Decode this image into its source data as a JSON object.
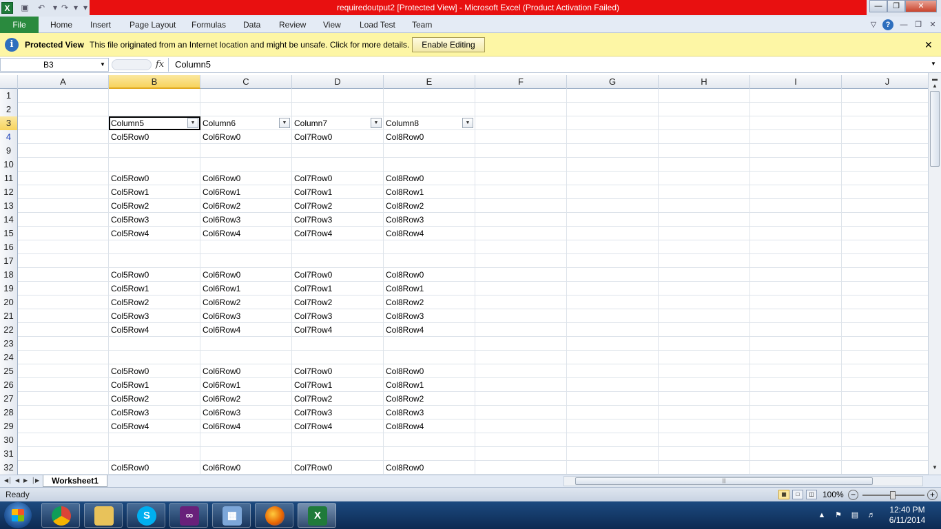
{
  "window": {
    "title": "requiredoutput2  [Protected View]  -  Microsoft Excel (Product Activation Failed)"
  },
  "ribbon": {
    "file_tab": "File",
    "tabs": [
      "Home",
      "Insert",
      "Page Layout",
      "Formulas",
      "Data",
      "Review",
      "View",
      "Load Test",
      "Team"
    ]
  },
  "protected_view": {
    "title": "Protected View",
    "message": "This file originated from an Internet location and might be unsafe. Click for more details.",
    "enable_button": "Enable Editing"
  },
  "formula_bar": {
    "name_box": "B3",
    "fx": "fx",
    "formula": "Column5"
  },
  "grid": {
    "selected_cell": "B3",
    "columns": [
      "A",
      "B",
      "C",
      "D",
      "E",
      "F",
      "G",
      "H",
      "I",
      "J"
    ],
    "rows": [
      {
        "num": "1",
        "cells": [
          "",
          "",
          "",
          "",
          ""
        ]
      },
      {
        "num": "2",
        "cells": [
          "",
          "",
          "",
          "",
          ""
        ]
      },
      {
        "num": "3",
        "cells": [
          "",
          "Column5",
          "Column6",
          "Column7",
          "Column8"
        ],
        "header": true
      },
      {
        "num": "4",
        "cells": [
          "",
          "Col5Row0",
          "Col6Row0",
          "Col7Row0",
          "Col8Row0"
        ],
        "filtered": true
      },
      {
        "num": "9",
        "cells": [
          "",
          "",
          "",
          "",
          ""
        ]
      },
      {
        "num": "10",
        "cells": [
          "",
          "",
          "",
          "",
          ""
        ]
      },
      {
        "num": "11",
        "cells": [
          "",
          "Col5Row0",
          "Col6Row0",
          "Col7Row0",
          "Col8Row0"
        ]
      },
      {
        "num": "12",
        "cells": [
          "",
          "Col5Row1",
          "Col6Row1",
          "Col7Row1",
          "Col8Row1"
        ]
      },
      {
        "num": "13",
        "cells": [
          "",
          "Col5Row2",
          "Col6Row2",
          "Col7Row2",
          "Col8Row2"
        ]
      },
      {
        "num": "14",
        "cells": [
          "",
          "Col5Row3",
          "Col6Row3",
          "Col7Row3",
          "Col8Row3"
        ]
      },
      {
        "num": "15",
        "cells": [
          "",
          "Col5Row4",
          "Col6Row4",
          "Col7Row4",
          "Col8Row4"
        ]
      },
      {
        "num": "16",
        "cells": [
          "",
          "",
          "",
          "",
          ""
        ]
      },
      {
        "num": "17",
        "cells": [
          "",
          "",
          "",
          "",
          ""
        ]
      },
      {
        "num": "18",
        "cells": [
          "",
          "Col5Row0",
          "Col6Row0",
          "Col7Row0",
          "Col8Row0"
        ]
      },
      {
        "num": "19",
        "cells": [
          "",
          "Col5Row1",
          "Col6Row1",
          "Col7Row1",
          "Col8Row1"
        ]
      },
      {
        "num": "20",
        "cells": [
          "",
          "Col5Row2",
          "Col6Row2",
          "Col7Row2",
          "Col8Row2"
        ]
      },
      {
        "num": "21",
        "cells": [
          "",
          "Col5Row3",
          "Col6Row3",
          "Col7Row3",
          "Col8Row3"
        ]
      },
      {
        "num": "22",
        "cells": [
          "",
          "Col5Row4",
          "Col6Row4",
          "Col7Row4",
          "Col8Row4"
        ]
      },
      {
        "num": "23",
        "cells": [
          "",
          "",
          "",
          "",
          ""
        ]
      },
      {
        "num": "24",
        "cells": [
          "",
          "",
          "",
          "",
          ""
        ]
      },
      {
        "num": "25",
        "cells": [
          "",
          "Col5Row0",
          "Col6Row0",
          "Col7Row0",
          "Col8Row0"
        ]
      },
      {
        "num": "26",
        "cells": [
          "",
          "Col5Row1",
          "Col6Row1",
          "Col7Row1",
          "Col8Row1"
        ]
      },
      {
        "num": "27",
        "cells": [
          "",
          "Col5Row2",
          "Col6Row2",
          "Col7Row2",
          "Col8Row2"
        ]
      },
      {
        "num": "28",
        "cells": [
          "",
          "Col5Row3",
          "Col6Row3",
          "Col7Row3",
          "Col8Row3"
        ]
      },
      {
        "num": "29",
        "cells": [
          "",
          "Col5Row4",
          "Col6Row4",
          "Col7Row4",
          "Col8Row4"
        ]
      },
      {
        "num": "30",
        "cells": [
          "",
          "",
          "",
          "",
          ""
        ]
      },
      {
        "num": "31",
        "cells": [
          "",
          "",
          "",
          "",
          ""
        ]
      },
      {
        "num": "32",
        "cells": [
          "",
          "Col5Row0",
          "Col6Row0",
          "Col7Row0",
          "Col8Row0"
        ]
      }
    ]
  },
  "sheets": {
    "tabs": [
      "Worksheet1"
    ]
  },
  "status": {
    "ready": "Ready",
    "zoom": "100%"
  },
  "taskbar": {
    "apps": [
      "chrome-icon",
      "file-explorer-icon",
      "skype-icon",
      "visual-studio-icon",
      "network-app-icon",
      "firefox-icon",
      "excel-icon"
    ],
    "time": "12:40 PM",
    "date": "6/11/2014"
  },
  "colors": {
    "title_bar_alert": "#e81010",
    "file_tab": "#2a8a3e",
    "protected_view_bar": "#fdf6a5",
    "selected_header": "#f7d35c",
    "filtered_row_number": "#1a3fb8"
  }
}
